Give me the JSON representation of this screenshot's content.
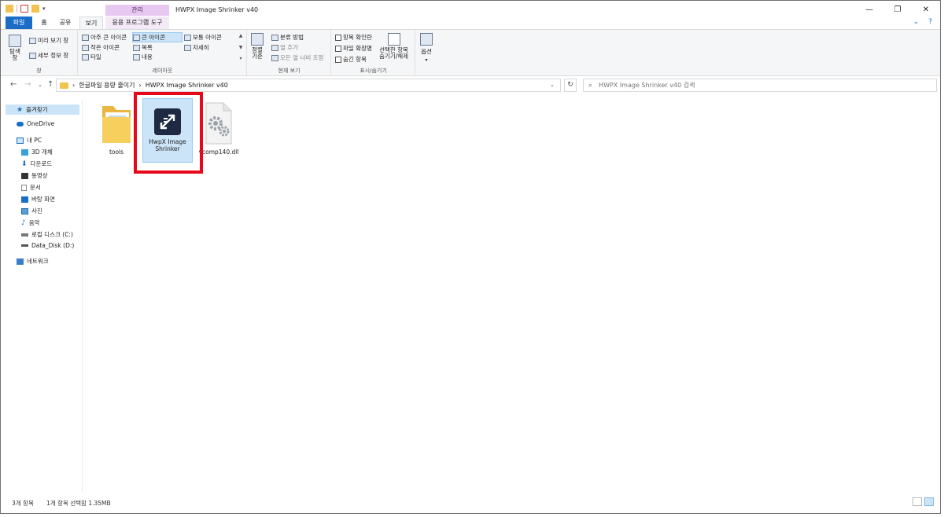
{
  "window": {
    "title": "HWPX Image Shrinker v40",
    "controls": {
      "minimize": "—",
      "maximize": "❐",
      "close": "✕"
    }
  },
  "tabs": {
    "file": "파일",
    "home": "홈",
    "share": "공유",
    "view": "보기",
    "contextual_header": "관리",
    "app_tools": "응용 프로그램 도구"
  },
  "ribbon": {
    "panes": {
      "nav_pane": "탐색\n창",
      "preview_pane": "미리 보기 창",
      "details_pane": "세부 정보 창",
      "label": "창"
    },
    "layout": {
      "extra_large": "아주 큰 아이콘",
      "large": "큰 아이콘",
      "medium": "보통 아이콘",
      "small": "작은 아이콘",
      "list": "목록",
      "details": "자세히",
      "tiles": "타일",
      "content": "내용",
      "label": "레이아웃"
    },
    "current_view": {
      "sort_by": "정렬\n기준",
      "group_by": "분류 방법",
      "add_columns": "열 추가",
      "size_all_columns": "모든 열 너비 조정",
      "label": "현재 보기"
    },
    "show_hide": {
      "item_checkboxes": "항목 확인란",
      "file_extensions": "파일 확장명",
      "hidden_items": "숨긴 항목",
      "hide_selected": "선택한 항목\n숨기기/해제",
      "label": "표시/숨기기"
    },
    "options": "옵션"
  },
  "address": {
    "crumbs": [
      "한글파일 용량 줄이기",
      "HWPX Image Shrinker v40"
    ],
    "search_placeholder": "HWPX Image Shrinker v40 검색"
  },
  "nav": {
    "quick_access": "즐겨찾기",
    "onedrive": "OneDrive",
    "this_pc": "내 PC",
    "objects_3d": "3D 개체",
    "downloads": "다운로드",
    "videos": "동영상",
    "documents": "문서",
    "desktop": "바탕 화면",
    "pictures": "사진",
    "music": "음악",
    "local_disk": "로컬 디스크 (C:)",
    "data_disk": "Data_Disk (D:)",
    "network": "네트워크"
  },
  "files": [
    {
      "name": "tools",
      "icon": "folder-icon"
    },
    {
      "name": "HwpX Image Shrinker",
      "icon": "app-icon"
    },
    {
      "name": "vcomp140.dll",
      "icon": "dll-gear-icon"
    }
  ],
  "status": {
    "count": "3개 항목",
    "selection": "1개 항목 선택함 1.35MB"
  },
  "colors": {
    "file_tab": "#1a6cc7",
    "contextual": "#e6c8f0",
    "selection": "#cce4f7",
    "highlight_box": "#e8081b",
    "app_icon_bg": "#1e2a44"
  }
}
